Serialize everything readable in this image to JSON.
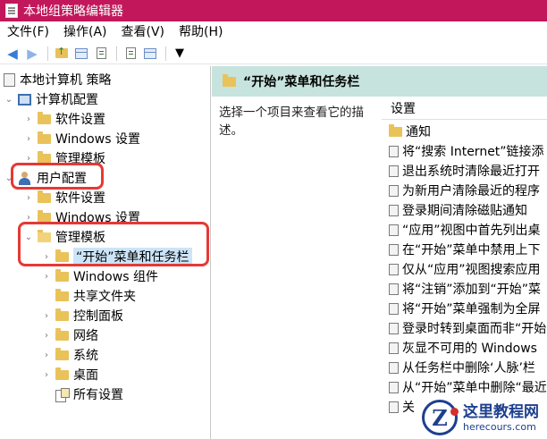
{
  "window": {
    "title": "本地组策略编辑器"
  },
  "menubar": {
    "items": [
      "文件(F)",
      "操作(A)",
      "查看(V)",
      "帮助(H)"
    ]
  },
  "toolbar": {
    "buttons": [
      "back-arrow-icon",
      "forward-arrow-icon",
      "folder-up-icon",
      "show-hide-tree-icon",
      "export-list-icon",
      "help-icon",
      "properties-icon",
      "filter-icon"
    ]
  },
  "tree": {
    "root": "本地计算机 策略",
    "computer_config": "计算机配置",
    "cc_software": "软件设置",
    "cc_windows": "Windows 设置",
    "cc_admin": "管理模板",
    "user_config": "用户配置",
    "uc_software": "软件设置",
    "uc_windows": "Windows 设置",
    "uc_admin": "管理模板",
    "start_menu": "“开始”菜单和任务栏",
    "windows_components": "Windows 组件",
    "shared_folders": "共享文件夹",
    "control_panel": "控制面板",
    "network": "网络",
    "system": "系统",
    "desktop": "桌面",
    "all_settings": "所有设置"
  },
  "right_pane": {
    "header": "“开始”菜单和任务栏",
    "description": "选择一个项目来查看它的描述。",
    "column_header": "设置",
    "rows": [
      "通知",
      "将“搜索 Internet”链接添",
      "退出系统时清除最近打开",
      "为新用户清除最近的程序",
      "登录期间清除磁贴通知",
      "“应用”视图中首先列出桌",
      "在“开始”菜单中禁用上下",
      "仅从“应用”视图搜索应用",
      "将“注销”添加到“开始”菜",
      "将“开始”菜单强制为全屏",
      "登录时转到桌面而非“开始",
      "灰显不可用的 Windows",
      "从任务栏中删除‘人脉’栏",
      "从“开始”菜单中删除“最近",
      "关"
    ]
  },
  "watermark": {
    "logo_letter": "Z",
    "title": "这里教程网",
    "url": "herecours.com"
  },
  "colors": {
    "titlebar": "#c2185b",
    "header_band": "#c7e3dd",
    "highlight": "#e53935",
    "folder": "#e9c25a"
  }
}
